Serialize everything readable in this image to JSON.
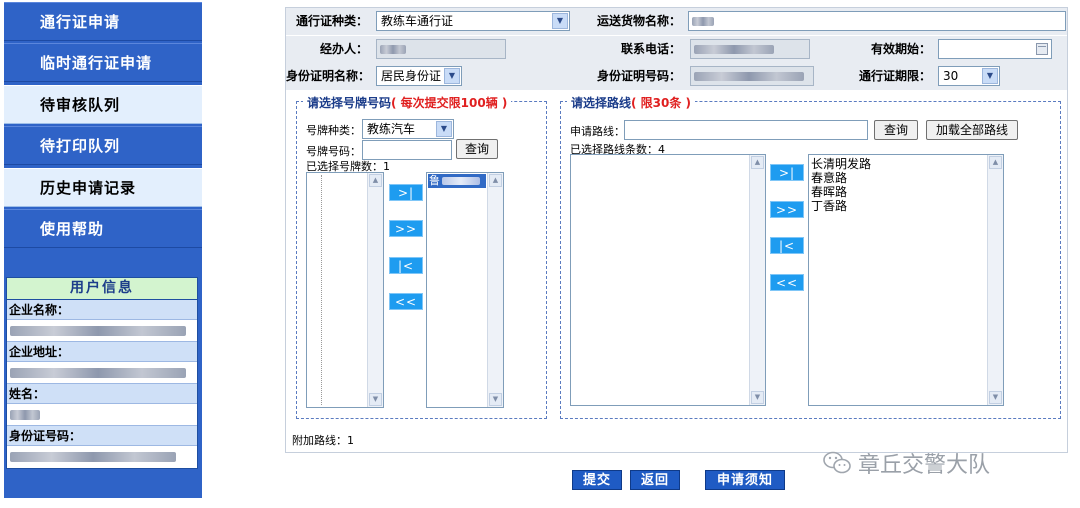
{
  "sidebar": {
    "items": [
      {
        "label": "通行证申请",
        "style": "blue"
      },
      {
        "label": "临时通行证申请",
        "style": "blue"
      },
      {
        "label": "待审核队列",
        "style": "light"
      },
      {
        "label": "待打印队列",
        "style": "blue"
      },
      {
        "label": "历史申请记录",
        "style": "light"
      },
      {
        "label": "使用帮助",
        "style": "blue"
      }
    ],
    "user_info": {
      "title": "用户信息",
      "company_name_label": "企业名称：",
      "company_address_label": "企业地址：",
      "name_label": "姓名：",
      "id_number_label": "身份证号码："
    }
  },
  "form": {
    "permit_type_label": "通行证种类：",
    "permit_type_value": "教练车通行证",
    "cargo_name_label": "运送货物名称：",
    "handler_label": "经办人：",
    "phone_label": "联系电话：",
    "valid_start_label": "有效期始：",
    "id_doc_name_label": "身份证明名称：",
    "id_doc_name_value": "居民身份证",
    "id_doc_number_label": "身份证明号码：",
    "permit_period_label": "通行证期限：",
    "permit_period_value": "30"
  },
  "plates": {
    "legend": "请选择号牌号码",
    "legend_note": "( 每次提交限100辆 )",
    "plate_type_label": "号牌种类：",
    "plate_type_value": "教练汽车",
    "plate_number_label": "号牌号码：",
    "query_button": "查询",
    "selected_count_label": "已选择号牌数：1",
    "selected_plate_prefix": "鲁"
  },
  "routes": {
    "legend": "请选择路线",
    "legend_note": "( 限30条 )",
    "apply_route_label": "申请路线：",
    "query_button": "查询",
    "load_all_button": "加载全部路线",
    "selected_count_label": "已选择路线条数：4",
    "selected_routes": [
      "长清明发路",
      "春意路",
      "春晖路",
      "丁香路"
    ]
  },
  "transfer_buttons": {
    "add_one": ">|",
    "add_all": ">>",
    "remove_one": "|<",
    "remove_all": "<<"
  },
  "extra_route_label": "附加路线：1",
  "actions": {
    "submit": "提交",
    "back": "返回",
    "notice": "申请须知"
  },
  "watermark": "章丘交警大队"
}
